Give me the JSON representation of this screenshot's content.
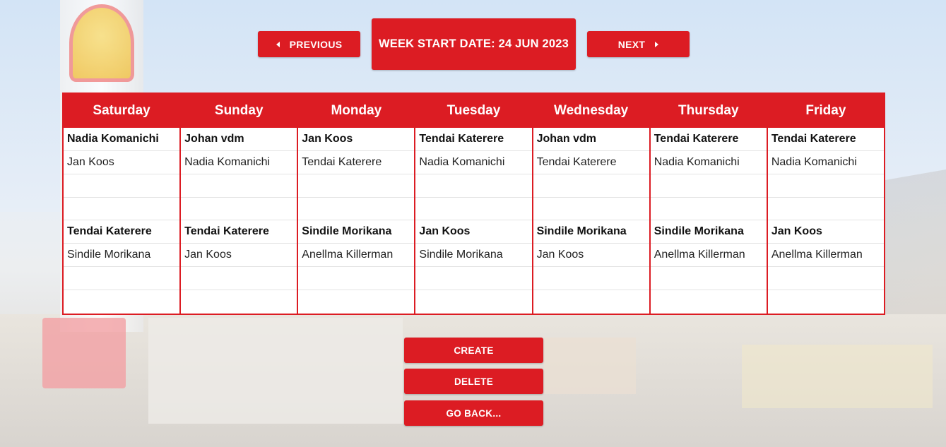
{
  "nav": {
    "previous_label": "PREVIOUS",
    "next_label": "NEXT",
    "week_start_label": "WEEK START DATE: 24 JUN 2023"
  },
  "roster": {
    "days": [
      {
        "name": "Saturday",
        "shifts": [
          [
            "Nadia Komanichi",
            "Jan Koos",
            "",
            ""
          ],
          [
            "Tendai Katerere",
            "Sindile Morikana",
            "",
            ""
          ]
        ]
      },
      {
        "name": "Sunday",
        "shifts": [
          [
            "Johan vdm",
            "Nadia Komanichi",
            "",
            ""
          ],
          [
            "Tendai Katerere",
            "Jan Koos",
            "",
            ""
          ]
        ]
      },
      {
        "name": "Monday",
        "shifts": [
          [
            "Jan Koos",
            "Tendai Katerere",
            "",
            ""
          ],
          [
            "Sindile Morikana",
            "Anellma Killerman",
            "",
            ""
          ]
        ]
      },
      {
        "name": "Tuesday",
        "shifts": [
          [
            "Tendai Katerere",
            "Nadia Komanichi",
            "",
            ""
          ],
          [
            "Jan Koos",
            "Sindile Morikana",
            "",
            ""
          ]
        ]
      },
      {
        "name": "Wednesday",
        "shifts": [
          [
            "Johan vdm",
            "Tendai Katerere",
            "",
            ""
          ],
          [
            "Sindile Morikana",
            "Jan Koos",
            "",
            ""
          ]
        ]
      },
      {
        "name": "Thursday",
        "shifts": [
          [
            "Tendai Katerere",
            "Nadia Komanichi",
            "",
            ""
          ],
          [
            "Sindile Morikana",
            "Anellma Killerman",
            "",
            ""
          ]
        ]
      },
      {
        "name": "Friday",
        "shifts": [
          [
            "Tendai Katerere",
            "Nadia Komanichi",
            "",
            ""
          ],
          [
            "Jan Koos",
            "Anellma Killerman",
            "",
            ""
          ]
        ]
      }
    ]
  },
  "actions": {
    "create_label": "CREATE",
    "delete_label": "DELETE",
    "go_back_label": "GO BACK..."
  },
  "colors": {
    "accent": "#dc1c23",
    "text": "#222222",
    "row_divider": "#e3e3e3"
  }
}
